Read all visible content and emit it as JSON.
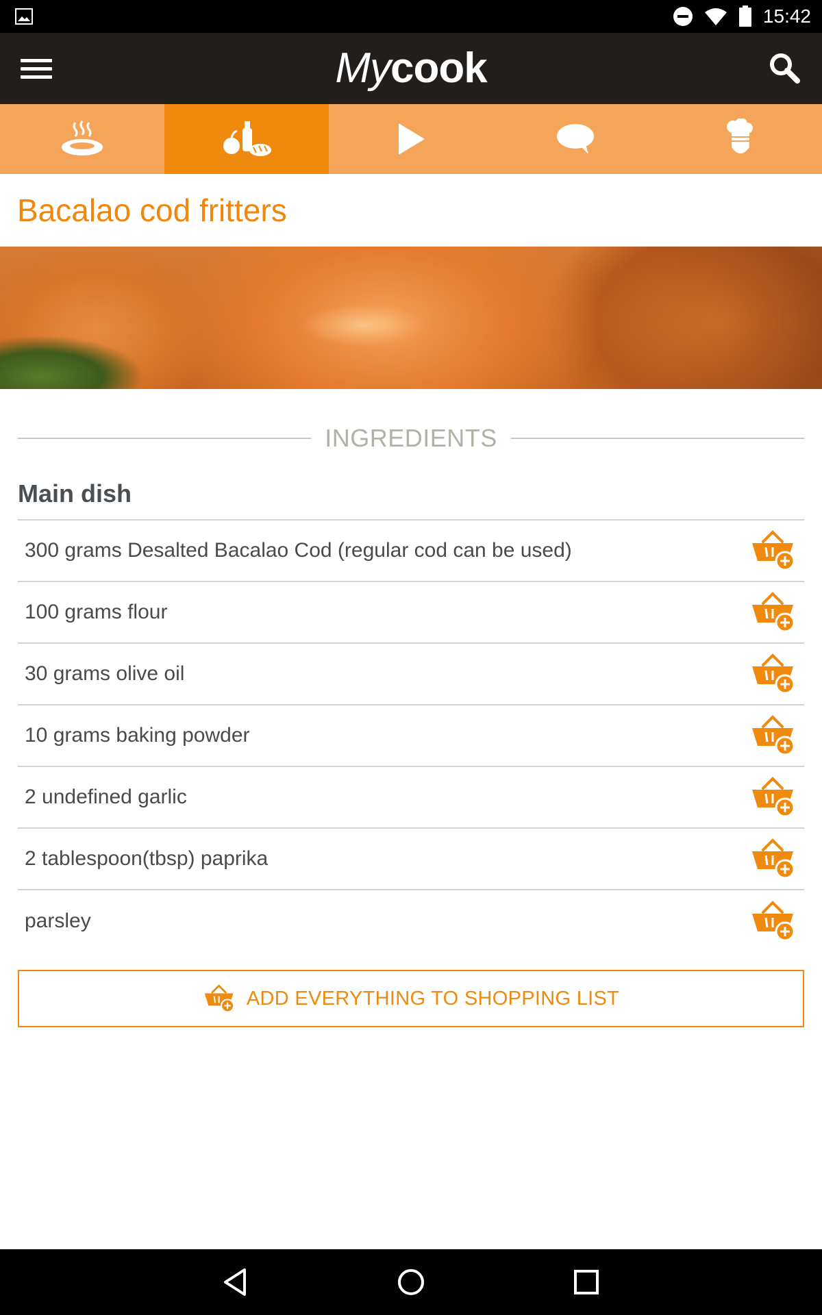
{
  "status_bar": {
    "time": "15:42",
    "icons": [
      "gallery-icon",
      "do-not-disturb-icon",
      "wifi-icon",
      "battery-icon"
    ]
  },
  "app_bar": {
    "logo_my": "My",
    "logo_cook": "cook",
    "menu_icon": "hamburger-menu-icon",
    "search_icon": "search-icon"
  },
  "tabs": [
    {
      "icon": "steaming-dish-icon",
      "active": false
    },
    {
      "icon": "ingredients-icon",
      "active": true
    },
    {
      "icon": "play-icon",
      "active": false
    },
    {
      "icon": "comment-icon",
      "active": false
    },
    {
      "icon": "chef-hat-icon",
      "active": false
    }
  ],
  "recipe": {
    "title": "Bacalao cod fritters"
  },
  "ingredients_section": {
    "heading": "INGREDIENTS",
    "group_title": "Main dish",
    "items": [
      {
        "text": "300 grams Desalted Bacalao Cod (regular cod can be used)"
      },
      {
        "text": "100 grams flour"
      },
      {
        "text": "30 grams olive oil"
      },
      {
        "text": "10 grams baking powder"
      },
      {
        "text": "2 undefined garlic"
      },
      {
        "text": "2 tablespoon(tbsp) paprika"
      },
      {
        "text": "parsley"
      }
    ],
    "add_all_label": "ADD EVERYTHING TO SHOPPING LIST"
  },
  "colors": {
    "accent": "#f08a0e",
    "tab_bar": "#f5a55a",
    "app_bar": "#221e1b"
  },
  "nav_bar": {
    "icons": [
      "back-icon",
      "home-icon",
      "recents-icon"
    ]
  }
}
